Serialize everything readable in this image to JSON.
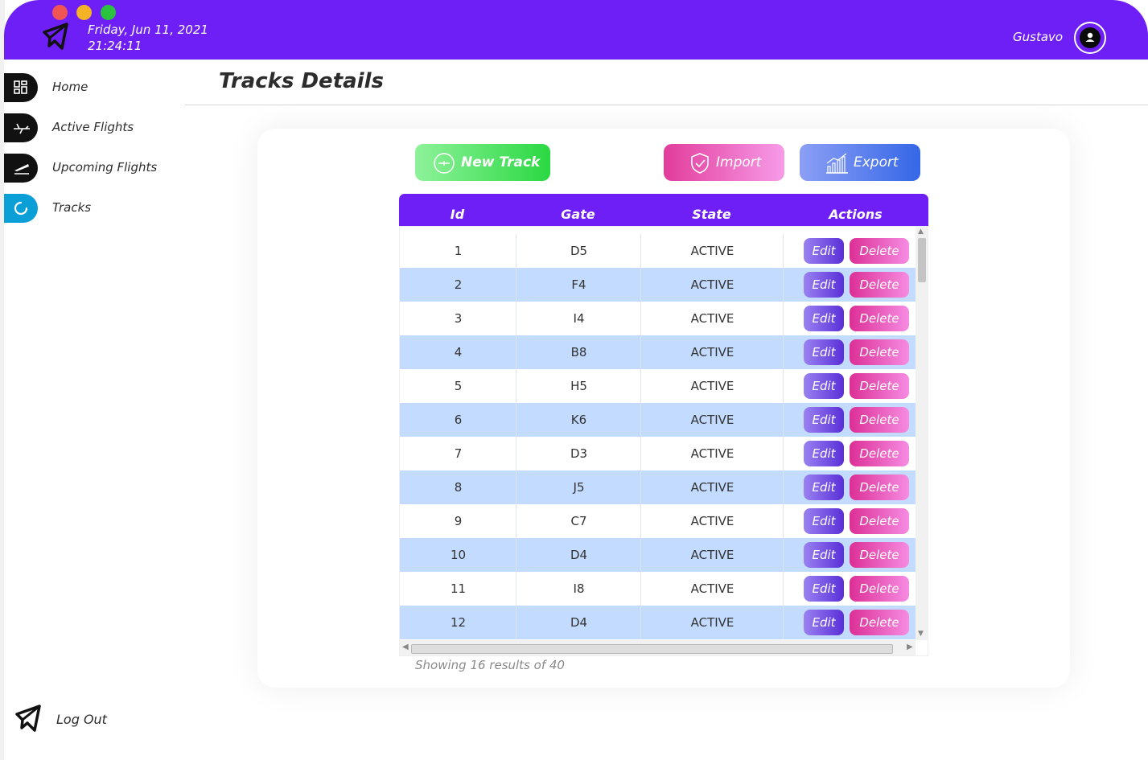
{
  "header": {
    "date": "Friday, Jun 11, 2021",
    "time": "21:24:11",
    "user_name": "Gustavo"
  },
  "sidebar": {
    "items": [
      {
        "label": "Home",
        "icon": "grid-icon",
        "active": false
      },
      {
        "label": "Active Flights",
        "icon": "plane-icon",
        "active": false
      },
      {
        "label": "Upcoming Flights",
        "icon": "takeoff-icon",
        "active": false
      },
      {
        "label": "Tracks",
        "icon": "loading-circle-icon",
        "active": true
      }
    ],
    "logout_label": "Log Out"
  },
  "page": {
    "title": "Tracks Details"
  },
  "toolbar": {
    "new_label": "New Track",
    "import_label": "Import",
    "export_label": "Export"
  },
  "table": {
    "columns": [
      "Id",
      "Gate",
      "State",
      "Actions"
    ],
    "edit_label": "Edit",
    "delete_label": "Delete",
    "rows": [
      {
        "id": "1",
        "gate": "D5",
        "state": "ACTIVE"
      },
      {
        "id": "2",
        "gate": "F4",
        "state": "ACTIVE"
      },
      {
        "id": "3",
        "gate": "I4",
        "state": "ACTIVE"
      },
      {
        "id": "4",
        "gate": "B8",
        "state": "ACTIVE"
      },
      {
        "id": "5",
        "gate": "H5",
        "state": "ACTIVE"
      },
      {
        "id": "6",
        "gate": "K6",
        "state": "ACTIVE"
      },
      {
        "id": "7",
        "gate": "D3",
        "state": "ACTIVE"
      },
      {
        "id": "8",
        "gate": "J5",
        "state": "ACTIVE"
      },
      {
        "id": "9",
        "gate": "C7",
        "state": "ACTIVE"
      },
      {
        "id": "10",
        "gate": "D4",
        "state": "ACTIVE"
      },
      {
        "id": "11",
        "gate": "I8",
        "state": "ACTIVE"
      },
      {
        "id": "12",
        "gate": "D4",
        "state": "ACTIVE"
      }
    ],
    "footer": "Showing 16 results of 40"
  },
  "colors": {
    "brand": "#6e1ff6",
    "row_alt": "#c2dbff",
    "active_nav": "#0b9fd8",
    "new_green": "#2bd843",
    "import_pink": "#e23c9b",
    "export_blue": "#3567e7"
  }
}
